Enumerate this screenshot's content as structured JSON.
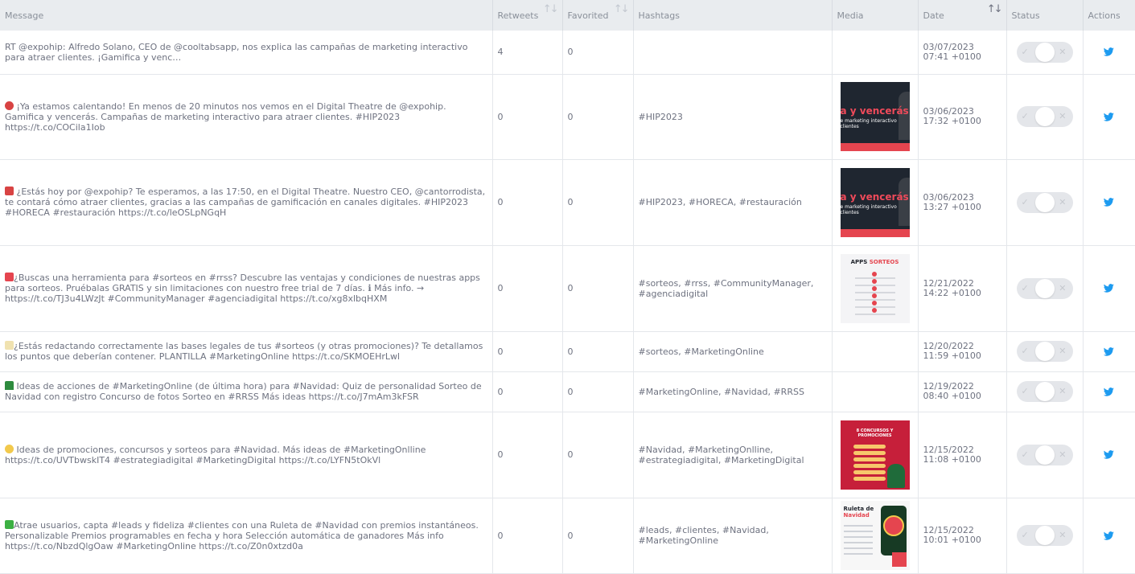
{
  "columns": {
    "message": "Message",
    "retweets": "Retweets",
    "favorited": "Favorited",
    "hashtags": "Hashtags",
    "media": "Media",
    "date": "Date",
    "status": "Status",
    "actions": "Actions"
  },
  "sort_glyph": "↑↓",
  "toggle": {
    "check": "✓",
    "cross": "✕"
  },
  "rows": [
    {
      "message": "RT @expohip: Alfredo Solano, CEO de @cooltabsapp, nos explica las campañas de marketing interactivo para atraer clientes. ¡Gamifica y venc…",
      "retweets": "4",
      "favorited": "0",
      "hashtags": "",
      "media": "none",
      "date": "03/07/2023",
      "time": "07:41 +0100"
    },
    {
      "message": " ¡Ya estamos calentando! En menos de 20 minutos nos vemos en el Digital Theatre de @expohip.  Gamifica y vencerás. Campañas de marketing interactivo para atraer clientes. #HIP2023 https://t.co/COCila1Iob",
      "retweets": "0",
      "favorited": "0",
      "hashtags": "#HIP2023",
      "media": "dark",
      "media_big": "a y vencerás",
      "media_small": "e marketing interactivo\nclientes",
      "date": "03/06/2023",
      "time": "17:32 +0100"
    },
    {
      "message": " ¿Estás hoy por @expohip? Te esperamos, a las 17:50, en el Digital Theatre. Nuestro CEO, @cantorrodista, te contará cómo atraer clientes, gracias a las campañas de gamificación en canales digitales. #HIP2023 #HORECA #restauración https://t.co/leOSLpNGqH",
      "retweets": "0",
      "favorited": "0",
      "hashtags": "#HIP2023, #HORECA, #restauración",
      "media": "dark",
      "media_big": "a y vencerás",
      "media_small": "e marketing interactivo\nclientes",
      "date": "03/06/2023",
      "time": "13:27 +0100"
    },
    {
      "message": "¿Buscas una herramienta para #sorteos en #rrss?  Descubre las ventajas y condiciones de nuestras apps para sorteos.  Pruébalas GRATIS y sin limitaciones con nuestro free trial de 7 días. ℹ Más info. → https://t.co/TJ3u4LWzJt #CommunityManager #agenciadigital https://t.co/xg8xlbqHXM",
      "retweets": "0",
      "favorited": "0",
      "hashtags": "#sorteos, #rrss, #CommunityManager, #agenciadigital",
      "media": "light",
      "media_title_a": "APPS ",
      "media_title_b": "SORTEOS",
      "date": "12/21/2022",
      "time": "14:22 +0100"
    },
    {
      "message": "¿Estás redactando correctamente las bases legales de tus #sorteos (y otras promociones)?  Te detallamos los puntos que deberían contener.  PLANTILLA #MarketingOnline https://t.co/SKMOEHrLwl",
      "retweets": "0",
      "favorited": "0",
      "hashtags": "#sorteos, #MarketingOnline",
      "media": "none",
      "date": "12/20/2022",
      "time": "11:59 +0100"
    },
    {
      "message": " Ideas de acciones de #MarketingOnline (de última hora) para #Navidad:  Quiz de personalidad  Sorteo de Navidad con registro  Concurso de fotos  Sorteo en #RRSS Más ideas  https://t.co/J7mAm3kFSR",
      "retweets": "0",
      "favorited": "0",
      "hashtags": "#MarketingOnline, #Navidad, #RRSS",
      "media": "none",
      "date": "12/19/2022",
      "time": "08:40 +0100"
    },
    {
      "message": " Ideas de promociones, concursos y sorteos para #Navidad.  Más ideas de #MarketingOnlline  https://t.co/UVTbwskIT4 #estrategiadigital #MarketingDigital https://t.co/LYFN5tOkVl",
      "retweets": "0",
      "favorited": "0",
      "hashtags": "#Navidad, #MarketingOnlline, #estrategiadigital, #MarketingDigital",
      "media": "red",
      "media_title": "8 CONCURSOS Y\nPROMOCIONES",
      "date": "12/15/2022",
      "time": "11:08 +0100"
    },
    {
      "message": "Atrae usuarios, capta #leads y fideliza #clientes con una Ruleta de #Navidad con premios instantáneos.  Personalizable  Premios programables en fecha y hora  Selección automática de ganadores Más info  https://t.co/NbzdQlgOaw #MarketingOnline https://t.co/Z0n0xtzd0a",
      "retweets": "0",
      "favorited": "0",
      "hashtags": "#leads, #clientes, #Navidad, #MarketingOnline",
      "media": "light2",
      "media_title_a": "Ruleta de\n",
      "media_title_b": "Navidad",
      "date": "12/15/2022",
      "time": "10:01 +0100"
    }
  ]
}
